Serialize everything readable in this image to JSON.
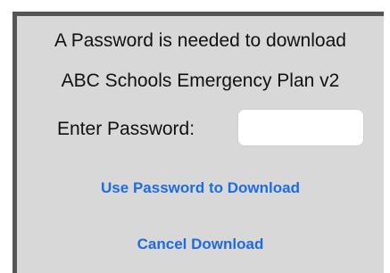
{
  "dialog": {
    "title": "A Password is needed to download",
    "document_name": "ABC Schools Emergency Plan v2",
    "password_label": "Enter Password:",
    "password_value": "",
    "use_password_label": "Use Password to Download",
    "cancel_label": "Cancel Download"
  },
  "colors": {
    "dialog_background": "#d8d8d8",
    "frame_border": "#555555",
    "link_text": "#1e6be6"
  }
}
